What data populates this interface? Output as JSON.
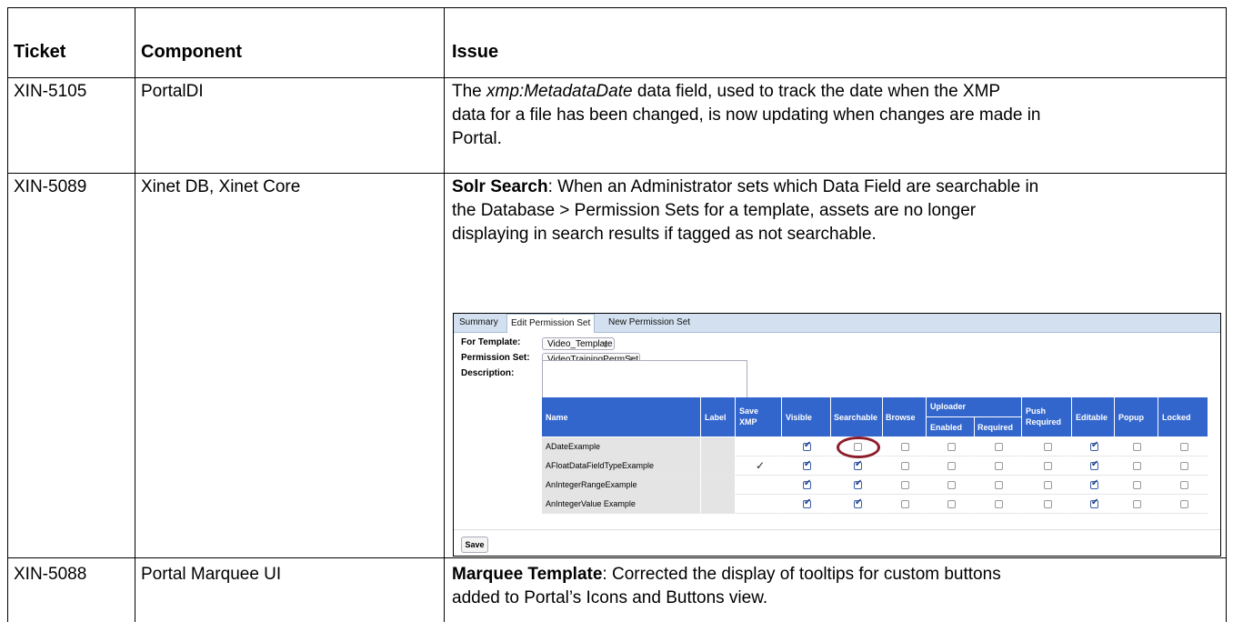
{
  "table": {
    "headers": {
      "ticket": "Ticket",
      "component": "Component",
      "issue": "Issue"
    },
    "rows": [
      {
        "ticket": "XIN-5105",
        "component": "PortalDI",
        "issue_pre": "The ",
        "issue_italic": "xmp:MetadataDate",
        "issue_line1_rest": " data field, used to  track the date when the XMP",
        "issue_line2": "data for a file has been changed, is now updating when changes are made in",
        "issue_line3": "Portal."
      },
      {
        "ticket": "XIN-5089",
        "component": "Xinet DB, Xinet Core",
        "issue_bold": "Solr Search",
        "issue_line1_rest": ": When an Administrator sets which Data Field are searchable in",
        "issue_line2": "the Database > Permission Sets for a template, assets are no longer",
        "issue_line3": "displaying in search results if tagged as not searchable."
      },
      {
        "ticket": "XIN-5088",
        "component": "Portal Marquee UI",
        "issue_bold": "Marquee Template",
        "issue_line1_rest": ": Corrected the display of tooltips for custom buttons",
        "issue_line2": "added to Portal’s Icons and Buttons view."
      }
    ]
  },
  "screenshot": {
    "tabs": [
      "Summary",
      "Edit Permission Set",
      "New Permission Set"
    ],
    "active_tab": "Edit Permission Set",
    "form": {
      "template_label": "For Template:",
      "template_value": "Video_Template",
      "permset_label": "Permission Set:",
      "permset_value": "VideoTrainingPermSet",
      "description_label": "Description:"
    },
    "grid": {
      "headers": {
        "name": "Name",
        "label": "Label",
        "save_xmp_1": "Save",
        "save_xmp_2": "XMP",
        "visible": "Visible",
        "searchable": "Searchable",
        "browse": "Browse",
        "uploader": "Uploader",
        "enabled": "Enabled",
        "required": "Required",
        "push_1": "Push",
        "push_2": "Required",
        "editable": "Editable",
        "popup": "Popup",
        "locked": "Locked"
      },
      "rows": [
        {
          "name": "ADateExample",
          "save_xmp": false,
          "visible": true,
          "searchable": false,
          "browse": false,
          "enabled": false,
          "required": false,
          "push": false,
          "editable": true,
          "popup": false,
          "locked": false
        },
        {
          "name": "AFloatDataFieldTypeExample",
          "save_xmp": true,
          "visible": true,
          "searchable": true,
          "browse": false,
          "enabled": false,
          "required": false,
          "push": false,
          "editable": true,
          "popup": false,
          "locked": false
        },
        {
          "name": "AnIntegerRangeExample",
          "save_xmp": false,
          "visible": true,
          "searchable": true,
          "browse": false,
          "enabled": false,
          "required": false,
          "push": false,
          "editable": true,
          "popup": false,
          "locked": false
        },
        {
          "name": "AnIntegerValue Example",
          "save_xmp": false,
          "visible": true,
          "searchable": true,
          "browse": false,
          "enabled": false,
          "required": false,
          "push": false,
          "editable": true,
          "popup": false,
          "locked": false
        }
      ]
    },
    "save_button": "Save"
  }
}
